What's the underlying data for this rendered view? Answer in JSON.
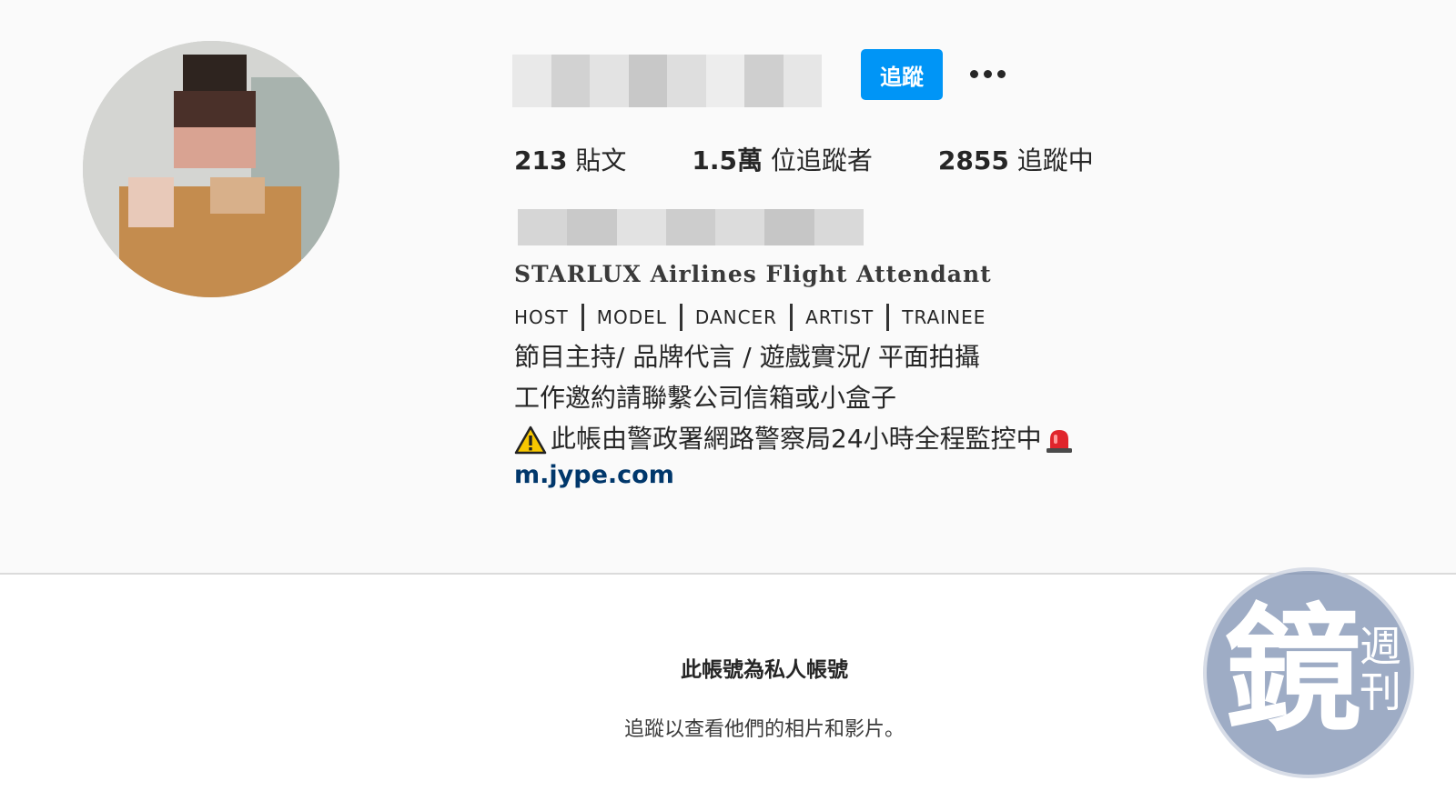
{
  "profile": {
    "follow_label": "追蹤",
    "stats": [
      {
        "num": "213",
        "label": "貼文"
      },
      {
        "num": "1.5萬",
        "label": "位追蹤者"
      },
      {
        "num": "2855",
        "label": "追蹤中"
      }
    ],
    "bio_title": "STARLUX Airlines Flight Attendant",
    "roles": [
      "HOST",
      "MODEL",
      "DANCER",
      "ARTIST",
      "TRAINEE"
    ],
    "bio_line1": "節目主持/ 品牌代言 / 遊戲實況/ 平面拍攝",
    "bio_line2": "工作邀約請聯繫公司信箱或小盒子",
    "bio_line3": "此帳由警政署網路警察局24小時全程監控中",
    "link": "m.jype.com"
  },
  "private": {
    "title": "此帳號為私人帳號",
    "subtitle": "追蹤以查看他們的相片和影片。"
  },
  "watermark": {
    "main": "鏡",
    "side": "週刊"
  },
  "colors": {
    "accent": "#0095f6",
    "link": "#00376b",
    "watermark": "#788caf"
  },
  "icons": [
    "more-options-icon",
    "warning-icon",
    "siren-icon"
  ]
}
